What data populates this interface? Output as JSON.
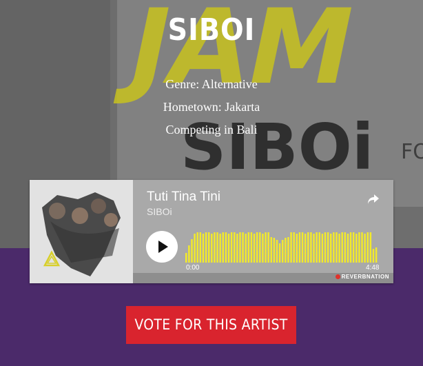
{
  "artist": {
    "name": "SIBOI",
    "genre": "Genre: Alternative",
    "hometown": "Hometown: Jakarta",
    "competing": "Competing in Bali"
  },
  "player": {
    "track_title": "Tuti Tina Tini",
    "track_artist": "SIBOi",
    "time_start": "0:00",
    "time_end": "4:48",
    "brand": "REVERBNATION",
    "icons": [
      "share-icon",
      "play-icon"
    ]
  },
  "cta": {
    "label": "VOTE FOR THIS ARTIST"
  },
  "colors": {
    "purple": "#4b2a6a",
    "vote_red": "#d9242e",
    "wave_yellow": "#f3ea2a",
    "hero_gray": "#6b6b6b"
  },
  "background_text": {
    "top": "JAM",
    "logo": "SIBOi",
    "side": "FO"
  }
}
